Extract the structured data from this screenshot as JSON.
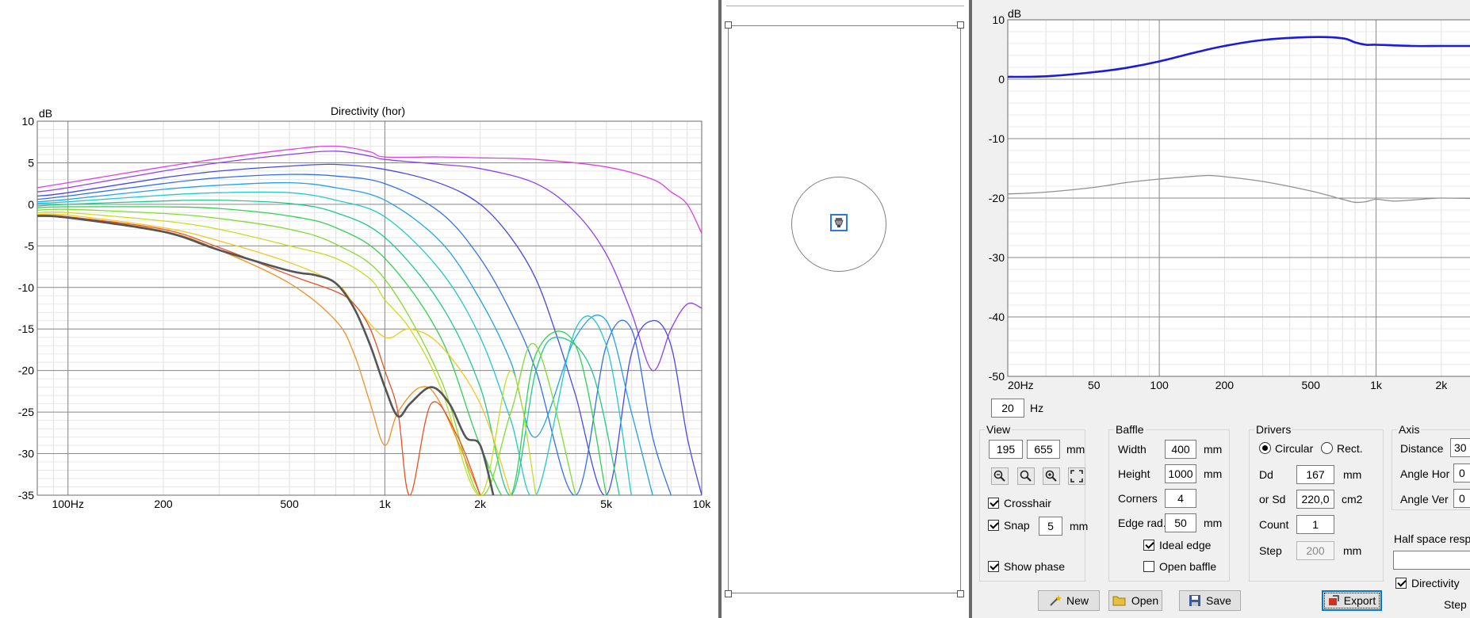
{
  "directivity_plot": {
    "y_unit": "dB",
    "title": "Directivity (hor)",
    "chart_data": {
      "type": "line",
      "title": "Directivity (hor)",
      "ylabel": "dB",
      "x_scale": "log",
      "xlim": [
        80,
        10000
      ],
      "ylim": [
        -35,
        10
      ],
      "grid": true,
      "y_ticks": [
        "10",
        "5",
        "0",
        "-5",
        "-10",
        "-15",
        "-20",
        "-25",
        "-30",
        "-35"
      ],
      "x_ticks": [
        "100Hz",
        "200",
        "500",
        "1k",
        "2k",
        "5k",
        "10k"
      ],
      "series": [
        {
          "color": "#e040e0",
          "x": [
            80,
            100,
            200,
            300,
            500,
            700,
            900,
            1000,
            1500,
            2000,
            3000,
            5000,
            7000,
            8000,
            9000,
            10000
          ],
          "y": [
            2.0,
            2.6,
            4.5,
            5.5,
            6.6,
            7.0,
            6.3,
            5.7,
            5.7,
            5.6,
            5.4,
            4.5,
            3.0,
            1.5,
            0,
            -3.5
          ]
        },
        {
          "color": "#9040f0",
          "x": [
            80,
            100,
            200,
            300,
            500,
            700,
            900,
            1000,
            1500,
            2000,
            3000,
            4000,
            5000,
            6000,
            7000,
            8000,
            9000,
            10000
          ],
          "y": [
            1.5,
            2.0,
            4.0,
            5.0,
            6.0,
            6.4,
            5.8,
            5.4,
            4.8,
            4.3,
            2.5,
            -1.0,
            -6.0,
            -13,
            -20,
            -15,
            -12,
            -12.5
          ]
        },
        {
          "color": "#4848e8",
          "x": [
            80,
            100,
            200,
            300,
            500,
            700,
            1000,
            1500,
            2000,
            2500,
            3000,
            3500,
            4000,
            5000,
            6000,
            7000,
            8000,
            9000,
            10000
          ],
          "y": [
            1.0,
            1.4,
            3.2,
            4.0,
            4.6,
            4.8,
            4.2,
            2.5,
            0.0,
            -4,
            -9,
            -16,
            -23,
            -35,
            -18,
            -14,
            -17,
            -28,
            -35
          ]
        },
        {
          "color": "#3070f0",
          "x": [
            80,
            100,
            200,
            300,
            500,
            700,
            1000,
            1500,
            2000,
            2500,
            3000,
            4000,
            5000,
            6000,
            7000,
            8000
          ],
          "y": [
            0.6,
            1.0,
            2.5,
            3.2,
            3.6,
            3.4,
            2.5,
            -1.0,
            -6.5,
            -13,
            -20,
            -35,
            -17,
            -15,
            -28,
            -35
          ]
        },
        {
          "color": "#20a0f0",
          "x": [
            80,
            100,
            200,
            300,
            500,
            700,
            1000,
            1500,
            2000,
            2500,
            3000,
            4000,
            5000,
            6000,
            7000
          ],
          "y": [
            0.3,
            0.6,
            1.8,
            2.3,
            2.6,
            2.0,
            0.5,
            -4.5,
            -11.5,
            -19,
            -28,
            -16,
            -14,
            -25,
            -35
          ]
        },
        {
          "color": "#20c8d0",
          "x": [
            80,
            100,
            200,
            300,
            500,
            700,
            1000,
            1500,
            2000,
            2500,
            3000,
            4000,
            5000,
            6000
          ],
          "y": [
            0.1,
            0.3,
            1.1,
            1.4,
            1.4,
            0.5,
            -1.5,
            -8,
            -16,
            -26,
            -35,
            -15,
            -17,
            -35
          ]
        },
        {
          "color": "#20c890",
          "x": [
            80,
            100,
            200,
            300,
            500,
            700,
            1000,
            1500,
            2000,
            2500,
            3000,
            3500,
            4500,
            5500
          ],
          "y": [
            -0.2,
            0,
            0.4,
            0.5,
            0.1,
            -1.0,
            -4.0,
            -12,
            -22,
            -35,
            -20,
            -16,
            -20,
            -35
          ]
        },
        {
          "color": "#30d050",
          "x": [
            80,
            100,
            200,
            300,
            500,
            700,
            1000,
            1500,
            2000,
            2500,
            3000,
            4000,
            5000
          ],
          "y": [
            -0.4,
            -0.3,
            -0.3,
            -0.5,
            -1.4,
            -2.8,
            -6.5,
            -16,
            -29,
            -35,
            -18,
            -17,
            -35
          ]
        },
        {
          "color": "#80dc30",
          "x": [
            80,
            100,
            200,
            300,
            500,
            700,
            1000,
            1500,
            2000,
            2500,
            3000,
            4000
          ],
          "y": [
            -0.7,
            -0.6,
            -1.1,
            -1.7,
            -3.0,
            -4.8,
            -9,
            -21,
            -35,
            -25,
            -17,
            -35
          ]
        },
        {
          "color": "#c8dc20",
          "x": [
            80,
            100,
            200,
            300,
            500,
            700,
            900,
            1000,
            1200,
            1500,
            2000,
            2500,
            3000
          ],
          "y": [
            -1.0,
            -1.0,
            -2.0,
            -3.0,
            -5.0,
            -6.5,
            -9,
            -11.5,
            -15,
            -22,
            -35,
            -20,
            -35
          ]
        },
        {
          "color": "#f0c820",
          "x": [
            80,
            100,
            200,
            300,
            500,
            700,
            800,
            1000,
            1200,
            1500,
            2000,
            2500
          ],
          "y": [
            -1.2,
            -1.3,
            -2.8,
            -4.4,
            -7.0,
            -9.5,
            -12,
            -16,
            -15,
            -17,
            -24,
            -35
          ]
        },
        {
          "color": "#f09020",
          "x": [
            80,
            100,
            200,
            300,
            500,
            700,
            800,
            900,
            1000,
            1100,
            1300,
            1500,
            2000
          ],
          "y": [
            -1.3,
            -1.5,
            -3.2,
            -5.5,
            -9.5,
            -14,
            -18,
            -24,
            -29,
            -25,
            -22,
            -24,
            -35
          ]
        },
        {
          "color": "#e85020",
          "x": [
            80,
            100,
            200,
            300,
            500,
            700,
            800,
            900,
            1000,
            1100,
            1200,
            1400,
            1700,
            2000
          ],
          "y": [
            -1.3,
            -1.5,
            -3.0,
            -5.2,
            -8.5,
            -10.5,
            -12,
            -15,
            -20,
            -25,
            -35,
            -24,
            -28,
            -35
          ]
        },
        {
          "color": "#555555",
          "width": 2.6,
          "x": [
            80,
            100,
            200,
            300,
            500,
            600,
            700,
            800,
            900,
            1000,
            1100,
            1200,
            1400,
            1600,
            1800,
            2000,
            2200
          ],
          "y": [
            -1.4,
            -1.6,
            -3.3,
            -5.5,
            -8.0,
            -8.5,
            -9.5,
            -12.5,
            -17,
            -22,
            -25.5,
            -24,
            -22,
            -24,
            -28,
            -29,
            -35
          ]
        }
      ]
    }
  },
  "side_view": {
    "driver_icon": "speaker-icon"
  },
  "frequency_plot": {
    "y_unit": "dB",
    "chart_data": {
      "type": "line",
      "ylabel": "dB",
      "x_scale": "log",
      "xlim": [
        20,
        3000
      ],
      "ylim": [
        -50,
        10
      ],
      "grid": true,
      "y_ticks": [
        "10",
        "0",
        "-10",
        "-20",
        "-30",
        "-40",
        "-50"
      ],
      "x_ticks": [
        "20Hz",
        "50",
        "100",
        "200",
        "500",
        "1k",
        "2k"
      ],
      "series": [
        {
          "color": "#1a1ae0",
          "width": 2.6,
          "x": [
            20,
            30,
            50,
            70,
            100,
            150,
            200,
            300,
            500,
            700,
            800,
            900,
            1000,
            1500,
            2000,
            3000
          ],
          "y": [
            0.4,
            0.5,
            1.2,
            1.9,
            3.0,
            4.6,
            5.6,
            6.6,
            7.1,
            6.9,
            6.2,
            5.8,
            5.8,
            5.6,
            5.6,
            5.6
          ]
        },
        {
          "color": "#909090",
          "x": [
            20,
            30,
            50,
            70,
            100,
            150,
            170,
            200,
            300,
            500,
            700,
            800,
            900,
            1000,
            1200,
            1500,
            2000,
            3000
          ],
          "y": [
            -19.3,
            -19.0,
            -18.2,
            -17.4,
            -16.8,
            -16.3,
            -16.2,
            -16.4,
            -17.2,
            -18.8,
            -20.2,
            -20.7,
            -20.6,
            -20.2,
            -20.5,
            -20.3,
            -20.0,
            -20.1
          ]
        }
      ]
    }
  },
  "freq_input": {
    "value": "20",
    "unit": "Hz"
  },
  "view_group": {
    "label": "View",
    "x_value": "195",
    "y_value": "655",
    "unit": "mm",
    "tools": [
      "zoom-out-icon",
      "zoom-icon",
      "zoom-in-icon",
      "fit-icon"
    ],
    "crosshair_label": "Crosshair",
    "crosshair_checked": true,
    "snap_label": "Snap",
    "snap_checked": true,
    "snap_value": "5",
    "snap_unit": "mm",
    "show_phase_label": "Show phase",
    "show_phase_checked": true
  },
  "baffle_group": {
    "label": "Baffle",
    "width_label": "Width",
    "width_value": "400",
    "width_unit": "mm",
    "height_label": "Height",
    "height_value": "1000",
    "height_unit": "mm",
    "corners_label": "Corners",
    "corners_value": "4",
    "edge_label": "Edge rad.",
    "edge_value": "50",
    "edge_unit": "mm",
    "ideal_edge_label": "Ideal edge",
    "ideal_edge_checked": true,
    "open_baffle_label": "Open baffle",
    "open_baffle_checked": false
  },
  "drivers_group": {
    "label": "Drivers",
    "circular_label": "Circular",
    "circular_selected": true,
    "rect_label": "Rect.",
    "rect_selected": false,
    "dd_label": "Dd",
    "dd_value": "167",
    "dd_unit": "mm",
    "sd_label": "or Sd",
    "sd_value": "220,0",
    "sd_unit": "cm2",
    "count_label": "Count",
    "count_value": "1",
    "step_label": "Step",
    "step_value": "200",
    "step_unit": "mm"
  },
  "axis_group": {
    "label": "Axis",
    "distance_label": "Distance",
    "distance_value": "30",
    "angle_hor_label": "Angle Hor",
    "angle_hor_value": "0",
    "angle_ver_label": "Angle Ver",
    "angle_ver_value": "0",
    "half_space_label": "Half space respo",
    "directivity_label": "Directivity",
    "directivity_checked": true,
    "step_label": "Step"
  },
  "buttons": {
    "new_label": "New",
    "new_icon": "wand-icon",
    "open_label": "Open",
    "open_icon": "folder-icon",
    "save_label": "Save",
    "save_icon": "disk-icon",
    "export_label": "Export",
    "export_icon": "export-icon"
  }
}
